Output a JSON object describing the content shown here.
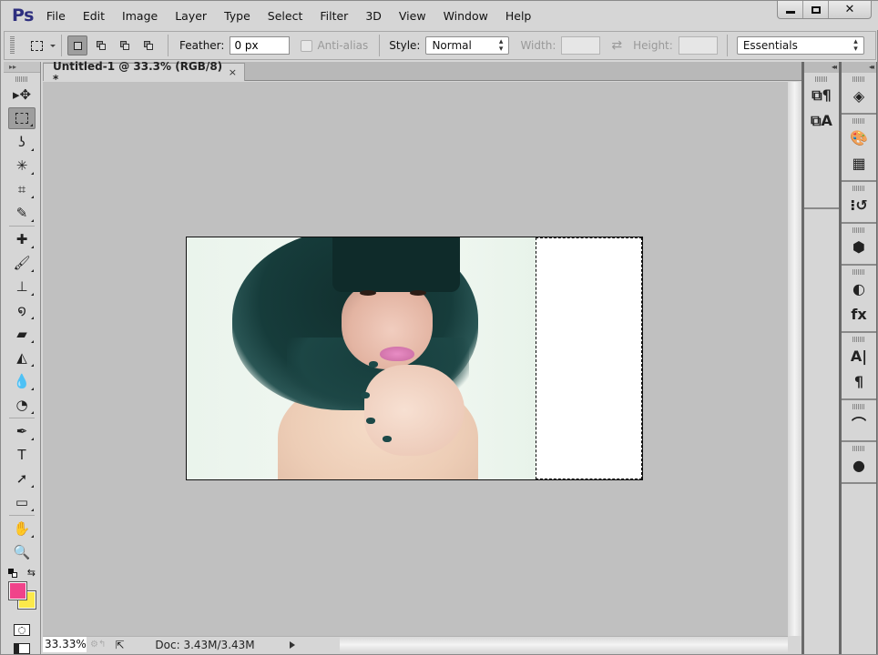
{
  "app": {
    "logo": "Ps",
    "menu": [
      "File",
      "Edit",
      "Image",
      "Layer",
      "Type",
      "Select",
      "Filter",
      "3D",
      "View",
      "Window",
      "Help"
    ],
    "window_controls": {
      "minimize": "minimize-icon",
      "maximize": "maximize-icon",
      "close": "✕"
    }
  },
  "options_bar": {
    "tool_preset_icon": "rectangular-marquee-icon",
    "selection_modes": [
      {
        "name": "new-selection",
        "active": true
      },
      {
        "name": "add-to-selection",
        "active": false
      },
      {
        "name": "subtract-from-selection",
        "active": false
      },
      {
        "name": "intersect-with-selection",
        "active": false
      }
    ],
    "feather_label": "Feather:",
    "feather_value": "0 px",
    "antialias_label": "Anti-alias",
    "antialias_checked": false,
    "style_label": "Style:",
    "style_value": "Normal",
    "width_label": "Width:",
    "width_value": "",
    "swap_icon": "⇄",
    "height_label": "Height:",
    "height_value": "",
    "workspace_value": "Essentials"
  },
  "document": {
    "tab_title": "Untitled-1 @ 33.3% (RGB/8) *",
    "tab_close": "×"
  },
  "tools": [
    {
      "name": "move-tool",
      "glyph": "▸✥",
      "active": false
    },
    {
      "name": "rectangular-marquee-tool",
      "glyph": "",
      "active": true
    },
    {
      "name": "lasso-tool",
      "glyph": "ʖ",
      "active": false
    },
    {
      "name": "magic-wand-tool",
      "glyph": "✳",
      "active": false
    },
    {
      "name": "crop-tool",
      "glyph": "⌗",
      "active": false
    },
    {
      "name": "eyedropper-tool",
      "glyph": "✎",
      "active": false
    },
    {
      "name": "spot-healing-tool",
      "glyph": "✚",
      "active": false
    },
    {
      "name": "brush-tool",
      "glyph": "🖌",
      "active": false
    },
    {
      "name": "clone-stamp-tool",
      "glyph": "⊥",
      "active": false
    },
    {
      "name": "history-brush-tool",
      "glyph": "໑",
      "active": false
    },
    {
      "name": "eraser-tool",
      "glyph": "▰",
      "active": false
    },
    {
      "name": "paint-bucket-tool",
      "glyph": "◭",
      "active": false
    },
    {
      "name": "blur-tool",
      "glyph": "💧",
      "active": false
    },
    {
      "name": "dodge-tool",
      "glyph": "◔",
      "active": false
    },
    {
      "name": "pen-tool",
      "glyph": "✒",
      "active": false
    },
    {
      "name": "type-tool",
      "glyph": "T",
      "active": false
    },
    {
      "name": "path-selection-tool",
      "glyph": "➚",
      "active": false
    },
    {
      "name": "rectangle-tool",
      "glyph": "▭",
      "active": false
    },
    {
      "name": "hand-tool",
      "glyph": "✋",
      "active": false
    },
    {
      "name": "zoom-tool",
      "glyph": "🔍",
      "active": false
    }
  ],
  "colors": {
    "foreground": "#f0438a",
    "background": "#fce94a"
  },
  "status": {
    "zoom": "33.33%",
    "doc_info": "Doc: 3.43M/3.43M"
  },
  "panels_mid": [
    {
      "name": "paragraph-styles-icon",
      "glyph": "⧉¶"
    },
    {
      "name": "character-styles-icon",
      "glyph": "⧉A"
    }
  ],
  "panels_right": [
    {
      "group": [
        {
          "name": "layers-icon",
          "glyph": "◈"
        }
      ]
    },
    {
      "group": [
        {
          "name": "color-palette-icon",
          "glyph": "🎨"
        },
        {
          "name": "swatches-icon",
          "glyph": "▦"
        }
      ]
    },
    {
      "group": [
        {
          "name": "history-icon",
          "glyph": "⁝↺"
        }
      ]
    },
    {
      "group": [
        {
          "name": "3d-icon",
          "glyph": "⬢"
        }
      ]
    },
    {
      "group": [
        {
          "name": "adjustments-icon",
          "glyph": "◐"
        },
        {
          "name": "styles-fx-icon",
          "glyph": "fx"
        }
      ]
    },
    {
      "group": [
        {
          "name": "character-icon",
          "glyph": "A|"
        },
        {
          "name": "paragraph-icon",
          "glyph": "¶"
        }
      ]
    },
    {
      "group": [
        {
          "name": "paths-icon",
          "glyph": "⌒"
        }
      ]
    },
    {
      "group": [
        {
          "name": "channels-icon",
          "glyph": "●"
        }
      ]
    }
  ]
}
